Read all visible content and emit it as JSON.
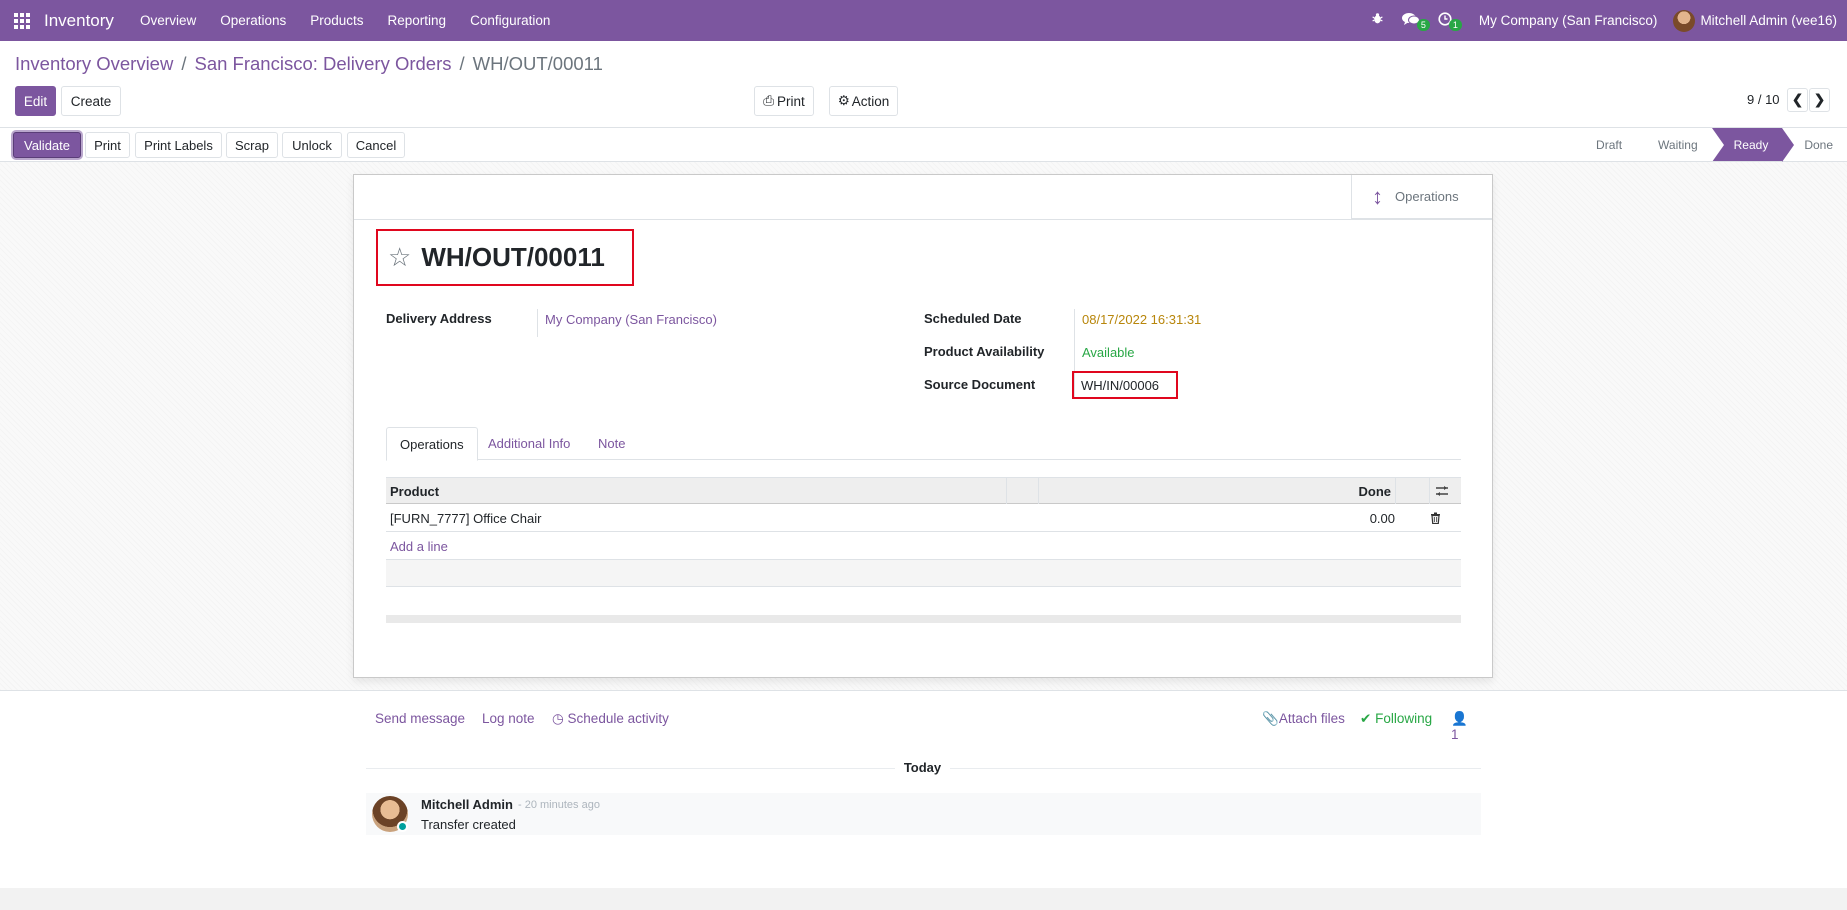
{
  "navbar": {
    "app_name": "Inventory",
    "menu": [
      "Overview",
      "Operations",
      "Products",
      "Reporting",
      "Configuration"
    ],
    "messages_count": "5",
    "activities_count": "1",
    "company": "My Company (San Francisco)",
    "user": "Mitchell Admin (vee16)",
    "bg_color": "#7c569f"
  },
  "breadcrumb": {
    "items": [
      "Inventory Overview",
      "San Francisco: Delivery Orders"
    ],
    "current": "WH/OUT/00011"
  },
  "control": {
    "edit": "Edit",
    "create": "Create",
    "print": "Print",
    "action": "Action",
    "pager": "9 / 10"
  },
  "statusbar": {
    "buttons": [
      "Validate",
      "Print",
      "Print Labels",
      "Scrap",
      "Unlock",
      "Cancel"
    ],
    "stages": [
      "Draft",
      "Waiting",
      "Ready",
      "Done"
    ],
    "active_stage": "Ready"
  },
  "form": {
    "smart_button": "Operations",
    "title": "WH/OUT/00011",
    "delivery_address_label": "Delivery Address",
    "delivery_address": "My Company (San Francisco)",
    "scheduled_date_label": "Scheduled Date",
    "scheduled_date": "08/17/2022 16:31:31",
    "availability_label": "Product Availability",
    "availability": "Available",
    "source_document_label": "Source Document",
    "source_document": "WH/IN/00006",
    "colors": {
      "date": "#b8860b",
      "available": "#28a745",
      "highlight": "#e0071e"
    }
  },
  "tabs": [
    "Operations",
    "Additional Info",
    "Note"
  ],
  "table": {
    "columns": [
      "Product",
      "Done"
    ],
    "rows": [
      {
        "product": "[FURN_7777] Office Chair",
        "done": "0.00"
      }
    ],
    "add_line": "Add a line"
  },
  "chatter": {
    "send_message": "Send message",
    "log_note": "Log note",
    "schedule_activity": "Schedule activity",
    "attach_files": "Attach files",
    "following": "Following",
    "followers": "1",
    "today": "Today",
    "message": {
      "author": "Mitchell Admin",
      "date": "- 20 minutes ago",
      "body": "Transfer created"
    }
  }
}
